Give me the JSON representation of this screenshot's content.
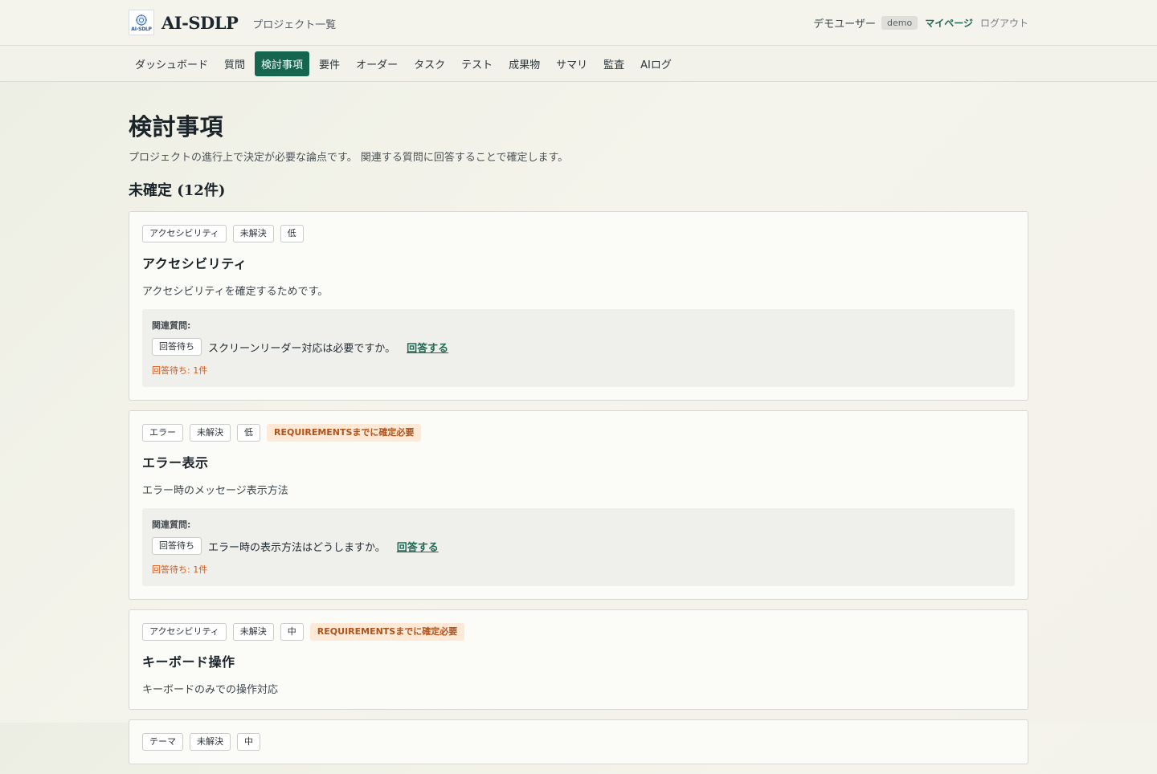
{
  "header": {
    "app_name": "AI-SDLP",
    "logo_text": "AI-SDLP",
    "project_link": "プロジェクト一覧",
    "username": "デモユーザー",
    "user_badge": "demo",
    "mypage": "マイページ",
    "logout": "ログアウト"
  },
  "nav": {
    "items": [
      {
        "label": "ダッシュボード"
      },
      {
        "label": "質問"
      },
      {
        "label": "検討事項",
        "active": true
      },
      {
        "label": "要件"
      },
      {
        "label": "オーダー"
      },
      {
        "label": "タスク"
      },
      {
        "label": "テスト"
      },
      {
        "label": "成果物"
      },
      {
        "label": "サマリ"
      },
      {
        "label": "監査"
      },
      {
        "label": "AIログ"
      }
    ]
  },
  "page": {
    "title": "検討事項",
    "description": "プロジェクトの進行上で決定が必要な論点です。 関連する質問に回答することで確定します。",
    "section_title": "未確定 (12件)"
  },
  "cards": [
    {
      "category": "アクセシビリティ",
      "status": "未解決",
      "priority": "低",
      "deadline": "",
      "title": "アクセシビリティ",
      "description": "アクセシビリティを確定するためです。",
      "related_label": "関連質問:",
      "question_status": "回答待ち",
      "question": "スクリーンリーダー対応は必要ですか。",
      "answer_link": "回答する",
      "pending": "回答待ち: 1件"
    },
    {
      "category": "エラー",
      "status": "未解決",
      "priority": "低",
      "deadline": "REQUIREMENTSまでに確定必要",
      "title": "エラー表示",
      "description": "エラー時のメッセージ表示方法",
      "related_label": "関連質問:",
      "question_status": "回答待ち",
      "question": "エラー時の表示方法はどうしますか。",
      "answer_link": "回答する",
      "pending": "回答待ち: 1件"
    },
    {
      "category": "アクセシビリティ",
      "status": "未解決",
      "priority": "中",
      "deadline": "REQUIREMENTSまでに確定必要",
      "title": "キーボード操作",
      "description": "キーボードのみでの操作対応"
    },
    {
      "category": "テーマ",
      "status": "未解決",
      "priority": "中",
      "deadline": ""
    }
  ],
  "colors": {
    "accent": "#16664f",
    "link": "#1f6a55",
    "deadline_bg": "#fde9d5",
    "deadline_text": "#b2521b",
    "pending_text": "#d65a17"
  }
}
